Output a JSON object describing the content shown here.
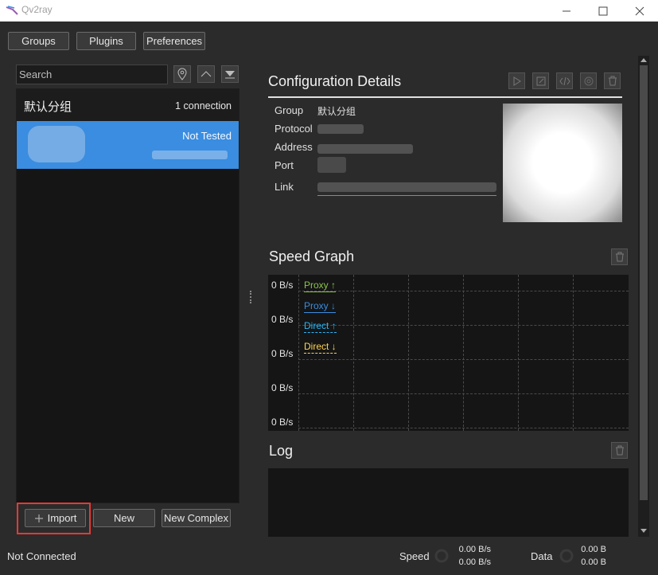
{
  "window": {
    "title": "Qv2ray",
    "minimize": "—",
    "maximize": "☐",
    "close": "✕"
  },
  "toolbar": {
    "groups": "Groups",
    "plugins": "Plugins",
    "preferences": "Preferences"
  },
  "search": {
    "placeholder": "Search"
  },
  "connection_list": {
    "group_name": "默认分组",
    "group_count": "1 connection",
    "connection_status": "Not Tested",
    "selected_color": "#3a8de0"
  },
  "bottom_buttons": {
    "import": "Import",
    "new": "New",
    "new_complex": "New Complex"
  },
  "details": {
    "title": "Configuration Details",
    "fields": {
      "group_label": "Group",
      "group_value": "默认分组",
      "protocol_label": "Protocol",
      "address_label": "Address",
      "port_label": "Port",
      "link_label": "Link"
    }
  },
  "speed_graph": {
    "title": "Speed Graph",
    "y_labels": [
      "0 B/s",
      "0 B/s",
      "0 B/s",
      "0 B/s",
      "0 B/s"
    ],
    "legend": [
      {
        "label": "Proxy ↑",
        "color": "#8bc34a"
      },
      {
        "label": "Proxy ↓",
        "color": "#3a8de0"
      },
      {
        "label": "Direct ↑",
        "color": "#29b6f6"
      },
      {
        "label": "Direct ↓",
        "color": "#ffd54f"
      }
    ]
  },
  "log": {
    "title": "Log"
  },
  "status": {
    "connection": "Not Connected",
    "speed_label": "Speed",
    "speed_up": "0.00 B/s",
    "speed_down": "0.00 B/s",
    "data_label": "Data",
    "data_up": "0.00 B",
    "data_down": "0.00 B"
  }
}
